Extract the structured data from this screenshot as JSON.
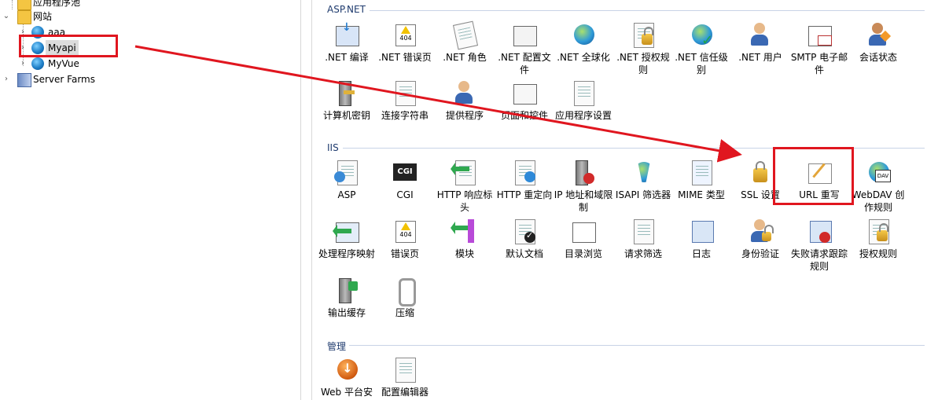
{
  "tree": {
    "items": [
      {
        "label": "应用程序池",
        "indent": 1
      },
      {
        "label": "网站",
        "indent": 0
      },
      {
        "label": "aaa",
        "indent": 1
      },
      {
        "label": "Myapi",
        "indent": 1
      },
      {
        "label": "MyVue",
        "indent": 1
      },
      {
        "label": "Server Farms",
        "indent": 0
      }
    ]
  },
  "sections": {
    "aspnet": {
      "title": "ASP.NET",
      "features": [
        {
          "label": ".NET 编译",
          "icon": "net-compile-icon"
        },
        {
          "label": ".NET 错误页",
          "icon": "net-error-pages-icon"
        },
        {
          "label": ".NET 角色",
          "icon": "net-roles-icon"
        },
        {
          "label": ".NET 配置文件",
          "icon": "net-profile-icon"
        },
        {
          "label": ".NET 全球化",
          "icon": "net-globalization-icon"
        },
        {
          "label": ".NET 授权规则",
          "icon": "net-authorization-icon"
        },
        {
          "label": ".NET 信任级别",
          "icon": "net-trust-levels-icon"
        },
        {
          "label": ".NET 用户",
          "icon": "net-users-icon"
        },
        {
          "label": "SMTP 电子邮件",
          "icon": "smtp-email-icon"
        },
        {
          "label": "会话状态",
          "icon": "session-state-icon"
        },
        {
          "label": "计算机密钥",
          "icon": "machine-key-icon"
        },
        {
          "label": "连接字符串",
          "icon": "connection-strings-icon"
        },
        {
          "label": "提供程序",
          "icon": "providers-icon"
        },
        {
          "label": "页面和控件",
          "icon": "pages-controls-icon"
        },
        {
          "label": "应用程序设置",
          "icon": "app-settings-icon"
        }
      ]
    },
    "iis": {
      "title": "IIS",
      "features": [
        {
          "label": "ASP",
          "icon": "asp-icon"
        },
        {
          "label": "CGI",
          "icon": "cgi-icon"
        },
        {
          "label": "HTTP 响应标头",
          "icon": "http-response-headers-icon"
        },
        {
          "label": "HTTP 重定向",
          "icon": "http-redirect-icon"
        },
        {
          "label": "IP 地址和域限制",
          "icon": "ip-domain-restrictions-icon"
        },
        {
          "label": "ISAPI 筛选器",
          "icon": "isapi-filters-icon"
        },
        {
          "label": "MIME 类型",
          "icon": "mime-types-icon"
        },
        {
          "label": "SSL 设置",
          "icon": "ssl-settings-icon"
        },
        {
          "label": "URL 重写",
          "icon": "url-rewrite-icon"
        },
        {
          "label": "WebDAV 创作规则",
          "icon": "webdav-authoring-icon"
        },
        {
          "label": "处理程序映射",
          "icon": "handler-mappings-icon"
        },
        {
          "label": "错误页",
          "icon": "error-pages-icon"
        },
        {
          "label": "模块",
          "icon": "modules-icon"
        },
        {
          "label": "默认文档",
          "icon": "default-document-icon"
        },
        {
          "label": "目录浏览",
          "icon": "directory-browsing-icon"
        },
        {
          "label": "请求筛选",
          "icon": "request-filtering-icon"
        },
        {
          "label": "日志",
          "icon": "logging-icon"
        },
        {
          "label": "身份验证",
          "icon": "authentication-icon"
        },
        {
          "label": "失败请求跟踪规则",
          "icon": "failed-request-tracing-icon"
        },
        {
          "label": "授权规则",
          "icon": "authorization-rules-icon"
        },
        {
          "label": "输出缓存",
          "icon": "output-caching-icon"
        },
        {
          "label": "压缩",
          "icon": "compression-icon"
        }
      ]
    },
    "management": {
      "title": "管理",
      "features": [
        {
          "label": "Web 平台安",
          "icon": "web-platform-installer-icon"
        },
        {
          "label": "配置编辑器",
          "icon": "configuration-editor-icon"
        }
      ]
    }
  },
  "colors": {
    "annotation": "#e0161f",
    "section_title": "#1f3b6e"
  }
}
